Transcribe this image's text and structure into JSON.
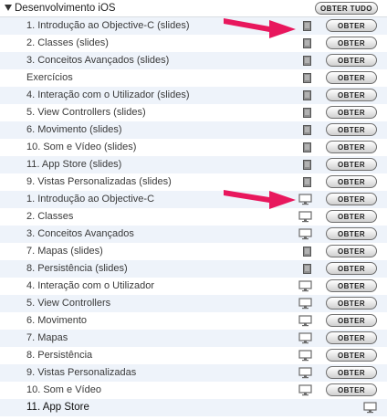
{
  "section": {
    "title": "Desenvolvimento iOS",
    "get_all_label": "OBTER TUDO"
  },
  "get_label": "OBTER",
  "items": [
    {
      "title": "1. Introdução ao Objective-C (slides)",
      "icon": "document-icon",
      "button": true
    },
    {
      "title": "2. Classes (slides)",
      "icon": "document-icon",
      "button": true
    },
    {
      "title": "3. Conceitos Avançados (slides)",
      "icon": "document-icon",
      "button": true
    },
    {
      "title": "Exercícios",
      "icon": "document-icon",
      "button": true
    },
    {
      "title": "4. Interação com o Utilizador (slides)",
      "icon": "document-icon",
      "button": true
    },
    {
      "title": "5. View Controllers (slides)",
      "icon": "document-icon",
      "button": true
    },
    {
      "title": "6. Movimento (slides)",
      "icon": "document-icon",
      "button": true
    },
    {
      "title": "10. Som e Vídeo (slides)",
      "icon": "document-icon",
      "button": true
    },
    {
      "title": "11. App Store (slides)",
      "icon": "document-icon",
      "button": true
    },
    {
      "title": "9. Vistas Personalizadas (slides)",
      "icon": "document-icon",
      "button": true
    },
    {
      "title": "1. Introdução ao Objective-C",
      "icon": "monitor-icon",
      "button": true
    },
    {
      "title": "2. Classes",
      "icon": "monitor-icon",
      "button": true
    },
    {
      "title": "3. Conceitos Avançados",
      "icon": "monitor-icon",
      "button": true
    },
    {
      "title": "7. Mapas (slides)",
      "icon": "document-icon",
      "button": true
    },
    {
      "title": "8. Persistência (slides)",
      "icon": "document-icon",
      "button": true
    },
    {
      "title": "4. Interação com o Utilizador",
      "icon": "monitor-icon",
      "button": true
    },
    {
      "title": "5. View Controllers",
      "icon": "monitor-icon",
      "button": true
    },
    {
      "title": "6. Movimento",
      "icon": "monitor-icon",
      "button": true
    },
    {
      "title": "7. Mapas",
      "icon": "monitor-icon",
      "button": true
    },
    {
      "title": "8. Persistência",
      "icon": "monitor-icon",
      "button": true
    },
    {
      "title": "9. Vistas Personalizadas",
      "icon": "monitor-icon",
      "button": true
    },
    {
      "title": "10. Som e Vídeo",
      "icon": "monitor-icon",
      "button": true
    },
    {
      "title": "11. App Store",
      "icon": "monitor-icon",
      "button": false
    }
  ],
  "annotation_color": "#e8175d"
}
